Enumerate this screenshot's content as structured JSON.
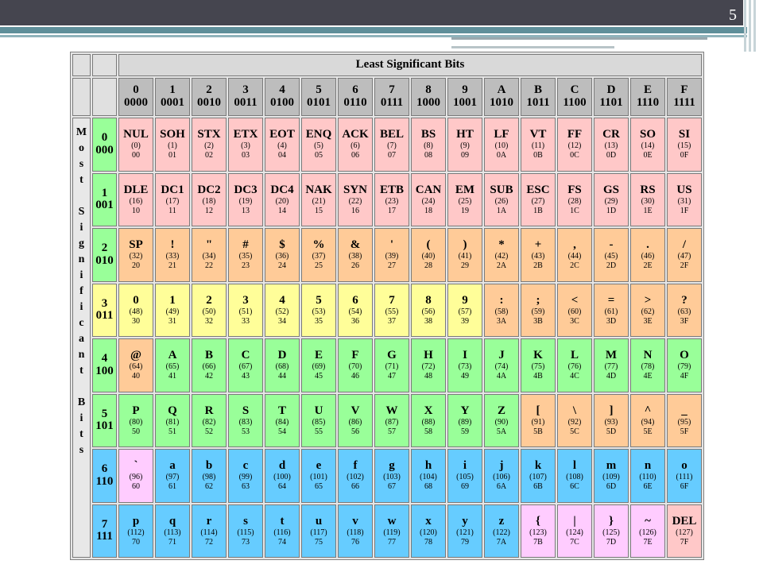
{
  "slide_number": "5",
  "header": {
    "title": "Least Significant Bits",
    "side_label": "Most Significant Bits"
  },
  "colors": {
    "pink": "#ffc8c8",
    "orange": "#ffcb98",
    "yellow": "#fffe99",
    "green": "#99ff99",
    "cyan": "#66ccff",
    "magenta": "#ffccff",
    "gray": "#bdbdbd"
  },
  "lsb_headers": [
    {
      "hex": "0",
      "bin": "0000"
    },
    {
      "hex": "1",
      "bin": "0001"
    },
    {
      "hex": "2",
      "bin": "0010"
    },
    {
      "hex": "3",
      "bin": "0011"
    },
    {
      "hex": "4",
      "bin": "0100"
    },
    {
      "hex": "5",
      "bin": "0101"
    },
    {
      "hex": "6",
      "bin": "0110"
    },
    {
      "hex": "7",
      "bin": "0111"
    },
    {
      "hex": "8",
      "bin": "1000"
    },
    {
      "hex": "9",
      "bin": "1001"
    },
    {
      "hex": "A",
      "bin": "1010"
    },
    {
      "hex": "B",
      "bin": "1011"
    },
    {
      "hex": "C",
      "bin": "1100"
    },
    {
      "hex": "D",
      "bin": "1101"
    },
    {
      "hex": "E",
      "bin": "1110"
    },
    {
      "hex": "F",
      "bin": "1111"
    }
  ],
  "rows": [
    {
      "hex": "0",
      "bin": "000",
      "color": "#99ff99",
      "cells": [
        {
          "s": "NUL",
          "d": "(0)",
          "h": "00",
          "c": "#ffc8c8"
        },
        {
          "s": "SOH",
          "d": "(1)",
          "h": "01",
          "c": "#ffc8c8"
        },
        {
          "s": "STX",
          "d": "(2)",
          "h": "02",
          "c": "#ffc8c8"
        },
        {
          "s": "ETX",
          "d": "(3)",
          "h": "03",
          "c": "#ffc8c8"
        },
        {
          "s": "EOT",
          "d": "(4)",
          "h": "04",
          "c": "#ffc8c8"
        },
        {
          "s": "ENQ",
          "d": "(5)",
          "h": "05",
          "c": "#ffc8c8"
        },
        {
          "s": "ACK",
          "d": "(6)",
          "h": "06",
          "c": "#ffc8c8"
        },
        {
          "s": "BEL",
          "d": "(7)",
          "h": "07",
          "c": "#ffc8c8"
        },
        {
          "s": "BS",
          "d": "(8)",
          "h": "08",
          "c": "#ffc8c8"
        },
        {
          "s": "HT",
          "d": "(9)",
          "h": "09",
          "c": "#ffc8c8"
        },
        {
          "s": "LF",
          "d": "(10)",
          "h": "0A",
          "c": "#ffc8c8"
        },
        {
          "s": "VT",
          "d": "(11)",
          "h": "0B",
          "c": "#ffc8c8"
        },
        {
          "s": "FF",
          "d": "(12)",
          "h": "0C",
          "c": "#ffc8c8"
        },
        {
          "s": "CR",
          "d": "(13)",
          "h": "0D",
          "c": "#ffc8c8"
        },
        {
          "s": "SO",
          "d": "(14)",
          "h": "0E",
          "c": "#ffc8c8"
        },
        {
          "s": "SI",
          "d": "(15)",
          "h": "0F",
          "c": "#ffc8c8"
        }
      ]
    },
    {
      "hex": "1",
      "bin": "001",
      "color": "#99ff99",
      "cells": [
        {
          "s": "DLE",
          "d": "(16)",
          "h": "10",
          "c": "#ffc8c8"
        },
        {
          "s": "DC1",
          "d": "(17)",
          "h": "11",
          "c": "#ffc8c8"
        },
        {
          "s": "DC2",
          "d": "(18)",
          "h": "12",
          "c": "#ffc8c8"
        },
        {
          "s": "DC3",
          "d": "(19)",
          "h": "13",
          "c": "#ffc8c8"
        },
        {
          "s": "DC4",
          "d": "(20)",
          "h": "14",
          "c": "#ffc8c8"
        },
        {
          "s": "NAK",
          "d": "(21)",
          "h": "15",
          "c": "#ffc8c8"
        },
        {
          "s": "SYN",
          "d": "(22)",
          "h": "16",
          "c": "#ffc8c8"
        },
        {
          "s": "ETB",
          "d": "(23)",
          "h": "17",
          "c": "#ffc8c8"
        },
        {
          "s": "CAN",
          "d": "(24)",
          "h": "18",
          "c": "#ffc8c8"
        },
        {
          "s": "EM",
          "d": "(25)",
          "h": "19",
          "c": "#ffc8c8"
        },
        {
          "s": "SUB",
          "d": "(26)",
          "h": "1A",
          "c": "#ffc8c8"
        },
        {
          "s": "ESC",
          "d": "(27)",
          "h": "1B",
          "c": "#ffc8c8"
        },
        {
          "s": "FS",
          "d": "(28)",
          "h": "1C",
          "c": "#ffc8c8"
        },
        {
          "s": "GS",
          "d": "(29)",
          "h": "1D",
          "c": "#ffc8c8"
        },
        {
          "s": "RS",
          "d": "(30)",
          "h": "1E",
          "c": "#ffc8c8"
        },
        {
          "s": "US",
          "d": "(31)",
          "h": "1F",
          "c": "#ffc8c8"
        }
      ]
    },
    {
      "hex": "2",
      "bin": "010",
      "color": "#99ff99",
      "cells": [
        {
          "s": "SP",
          "d": "(32)",
          "h": "20",
          "c": "#ffcb98"
        },
        {
          "s": "!",
          "d": "(33)",
          "h": "21",
          "c": "#ffcb98"
        },
        {
          "s": "\"",
          "d": "(34)",
          "h": "22",
          "c": "#ffcb98"
        },
        {
          "s": "#",
          "d": "(35)",
          "h": "23",
          "c": "#ffcb98"
        },
        {
          "s": "$",
          "d": "(36)",
          "h": "24",
          "c": "#ffcb98"
        },
        {
          "s": "%",
          "d": "(37)",
          "h": "25",
          "c": "#ffcb98"
        },
        {
          "s": "&",
          "d": "(38)",
          "h": "26",
          "c": "#ffcb98"
        },
        {
          "s": "'",
          "d": "(39)",
          "h": "27",
          "c": "#ffcb98"
        },
        {
          "s": "(",
          "d": "(40)",
          "h": "28",
          "c": "#ffcb98"
        },
        {
          "s": ")",
          "d": "(41)",
          "h": "29",
          "c": "#ffcb98"
        },
        {
          "s": "*",
          "d": "(42)",
          "h": "2A",
          "c": "#ffcb98"
        },
        {
          "s": "+",
          "d": "(43)",
          "h": "2B",
          "c": "#ffcb98"
        },
        {
          "s": ",",
          "d": "(44)",
          "h": "2C",
          "c": "#ffcb98"
        },
        {
          "s": "-",
          "d": "(45)",
          "h": "2D",
          "c": "#ffcb98"
        },
        {
          "s": ".",
          "d": "(46)",
          "h": "2E",
          "c": "#ffcb98"
        },
        {
          "s": "/",
          "d": "(47)",
          "h": "2F",
          "c": "#ffcb98"
        }
      ]
    },
    {
      "hex": "3",
      "bin": "011",
      "color": "#fffe99",
      "cells": [
        {
          "s": "0",
          "d": "(48)",
          "h": "30",
          "c": "#fffe99"
        },
        {
          "s": "1",
          "d": "(49)",
          "h": "31",
          "c": "#fffe99"
        },
        {
          "s": "2",
          "d": "(50)",
          "h": "32",
          "c": "#fffe99"
        },
        {
          "s": "3",
          "d": "(51)",
          "h": "33",
          "c": "#fffe99"
        },
        {
          "s": "4",
          "d": "(52)",
          "h": "34",
          "c": "#fffe99"
        },
        {
          "s": "5",
          "d": "(53)",
          "h": "35",
          "c": "#fffe99"
        },
        {
          "s": "6",
          "d": "(54)",
          "h": "36",
          "c": "#fffe99"
        },
        {
          "s": "7",
          "d": "(55)",
          "h": "37",
          "c": "#fffe99"
        },
        {
          "s": "8",
          "d": "(56)",
          "h": "38",
          "c": "#fffe99"
        },
        {
          "s": "9",
          "d": "(57)",
          "h": "39",
          "c": "#fffe99"
        },
        {
          "s": ":",
          "d": "(58)",
          "h": "3A",
          "c": "#ffcb98"
        },
        {
          "s": ";",
          "d": "(59)",
          "h": "3B",
          "c": "#ffcb98"
        },
        {
          "s": "<",
          "d": "(60)",
          "h": "3C",
          "c": "#ffcb98"
        },
        {
          "s": "=",
          "d": "(61)",
          "h": "3D",
          "c": "#ffcb98"
        },
        {
          "s": ">",
          "d": "(62)",
          "h": "3E",
          "c": "#ffcb98"
        },
        {
          "s": "?",
          "d": "(63)",
          "h": "3F",
          "c": "#ffcb98"
        }
      ]
    },
    {
      "hex": "4",
      "bin": "100",
      "color": "#99ff99",
      "cells": [
        {
          "s": "@",
          "d": "(64)",
          "h": "40",
          "c": "#ffcb98"
        },
        {
          "s": "A",
          "d": "(65)",
          "h": "41",
          "c": "#99ff99"
        },
        {
          "s": "B",
          "d": "(66)",
          "h": "42",
          "c": "#99ff99"
        },
        {
          "s": "C",
          "d": "(67)",
          "h": "43",
          "c": "#99ff99"
        },
        {
          "s": "D",
          "d": "(68)",
          "h": "44",
          "c": "#99ff99"
        },
        {
          "s": "E",
          "d": "(69)",
          "h": "45",
          "c": "#99ff99"
        },
        {
          "s": "F",
          "d": "(70)",
          "h": "46",
          "c": "#99ff99"
        },
        {
          "s": "G",
          "d": "(71)",
          "h": "47",
          "c": "#99ff99"
        },
        {
          "s": "H",
          "d": "(72)",
          "h": "48",
          "c": "#99ff99"
        },
        {
          "s": "I",
          "d": "(73)",
          "h": "49",
          "c": "#99ff99"
        },
        {
          "s": "J",
          "d": "(74)",
          "h": "4A",
          "c": "#99ff99"
        },
        {
          "s": "K",
          "d": "(75)",
          "h": "4B",
          "c": "#99ff99"
        },
        {
          "s": "L",
          "d": "(76)",
          "h": "4C",
          "c": "#99ff99"
        },
        {
          "s": "M",
          "d": "(77)",
          "h": "4D",
          "c": "#99ff99"
        },
        {
          "s": "N",
          "d": "(78)",
          "h": "4E",
          "c": "#99ff99"
        },
        {
          "s": "O",
          "d": "(79)",
          "h": "4F",
          "c": "#99ff99"
        }
      ]
    },
    {
      "hex": "5",
      "bin": "101",
      "color": "#99ff99",
      "cells": [
        {
          "s": "P",
          "d": "(80)",
          "h": "50",
          "c": "#99ff99"
        },
        {
          "s": "Q",
          "d": "(81)",
          "h": "51",
          "c": "#99ff99"
        },
        {
          "s": "R",
          "d": "(82)",
          "h": "52",
          "c": "#99ff99"
        },
        {
          "s": "S",
          "d": "(83)",
          "h": "53",
          "c": "#99ff99"
        },
        {
          "s": "T",
          "d": "(84)",
          "h": "54",
          "c": "#99ff99"
        },
        {
          "s": "U",
          "d": "(85)",
          "h": "55",
          "c": "#99ff99"
        },
        {
          "s": "V",
          "d": "(86)",
          "h": "56",
          "c": "#99ff99"
        },
        {
          "s": "W",
          "d": "(87)",
          "h": "57",
          "c": "#99ff99"
        },
        {
          "s": "X",
          "d": "(88)",
          "h": "58",
          "c": "#99ff99"
        },
        {
          "s": "Y",
          "d": "(89)",
          "h": "59",
          "c": "#99ff99"
        },
        {
          "s": "Z",
          "d": "(90)",
          "h": "5A",
          "c": "#99ff99"
        },
        {
          "s": "[",
          "d": "(91)",
          "h": "5B",
          "c": "#ffcb98"
        },
        {
          "s": "\\",
          "d": "(92)",
          "h": "5C",
          "c": "#ffcb98"
        },
        {
          "s": "]",
          "d": "(93)",
          "h": "5D",
          "c": "#ffcb98"
        },
        {
          "s": "^",
          "d": "(94)",
          "h": "5E",
          "c": "#ffcb98"
        },
        {
          "s": "_",
          "d": "(95)",
          "h": "5F",
          "c": "#ffcb98"
        }
      ]
    },
    {
      "hex": "6",
      "bin": "110",
      "color": "#66ccff",
      "cells": [
        {
          "s": "`",
          "d": "(96)",
          "h": "60",
          "c": "#ffccff"
        },
        {
          "s": "a",
          "d": "(97)",
          "h": "61",
          "c": "#66ccff"
        },
        {
          "s": "b",
          "d": "(98)",
          "h": "62",
          "c": "#66ccff"
        },
        {
          "s": "c",
          "d": "(99)",
          "h": "63",
          "c": "#66ccff"
        },
        {
          "s": "d",
          "d": "(100)",
          "h": "64",
          "c": "#66ccff"
        },
        {
          "s": "e",
          "d": "(101)",
          "h": "65",
          "c": "#66ccff"
        },
        {
          "s": "f",
          "d": "(102)",
          "h": "66",
          "c": "#66ccff"
        },
        {
          "s": "g",
          "d": "(103)",
          "h": "67",
          "c": "#66ccff"
        },
        {
          "s": "h",
          "d": "(104)",
          "h": "68",
          "c": "#66ccff"
        },
        {
          "s": "i",
          "d": "(105)",
          "h": "69",
          "c": "#66ccff"
        },
        {
          "s": "j",
          "d": "(106)",
          "h": "6A",
          "c": "#66ccff"
        },
        {
          "s": "k",
          "d": "(107)",
          "h": "6B",
          "c": "#66ccff"
        },
        {
          "s": "l",
          "d": "(108)",
          "h": "6C",
          "c": "#66ccff"
        },
        {
          "s": "m",
          "d": "(109)",
          "h": "6D",
          "c": "#66ccff"
        },
        {
          "s": "n",
          "d": "(110)",
          "h": "6E",
          "c": "#66ccff"
        },
        {
          "s": "o",
          "d": "(111)",
          "h": "6F",
          "c": "#66ccff"
        }
      ]
    },
    {
      "hex": "7",
      "bin": "111",
      "color": "#66ccff",
      "cells": [
        {
          "s": "p",
          "d": "(112)",
          "h": "70",
          "c": "#66ccff"
        },
        {
          "s": "q",
          "d": "(113)",
          "h": "71",
          "c": "#66ccff"
        },
        {
          "s": "r",
          "d": "(114)",
          "h": "72",
          "c": "#66ccff"
        },
        {
          "s": "s",
          "d": "(115)",
          "h": "73",
          "c": "#66ccff"
        },
        {
          "s": "t",
          "d": "(116)",
          "h": "74",
          "c": "#66ccff"
        },
        {
          "s": "u",
          "d": "(117)",
          "h": "75",
          "c": "#66ccff"
        },
        {
          "s": "v",
          "d": "(118)",
          "h": "76",
          "c": "#66ccff"
        },
        {
          "s": "w",
          "d": "(119)",
          "h": "77",
          "c": "#66ccff"
        },
        {
          "s": "x",
          "d": "(120)",
          "h": "78",
          "c": "#66ccff"
        },
        {
          "s": "y",
          "d": "(121)",
          "h": "79",
          "c": "#66ccff"
        },
        {
          "s": "z",
          "d": "(122)",
          "h": "7A",
          "c": "#66ccff"
        },
        {
          "s": "{",
          "d": "(123)",
          "h": "7B",
          "c": "#ffccff"
        },
        {
          "s": "|",
          "d": "(124)",
          "h": "7C",
          "c": "#ffccff"
        },
        {
          "s": "}",
          "d": "(125)",
          "h": "7D",
          "c": "#ffccff"
        },
        {
          "s": "~",
          "d": "(126)",
          "h": "7E",
          "c": "#ffccff"
        },
        {
          "s": "DEL",
          "d": "(127)",
          "h": "7F",
          "c": "#ffc8c8"
        }
      ]
    }
  ]
}
